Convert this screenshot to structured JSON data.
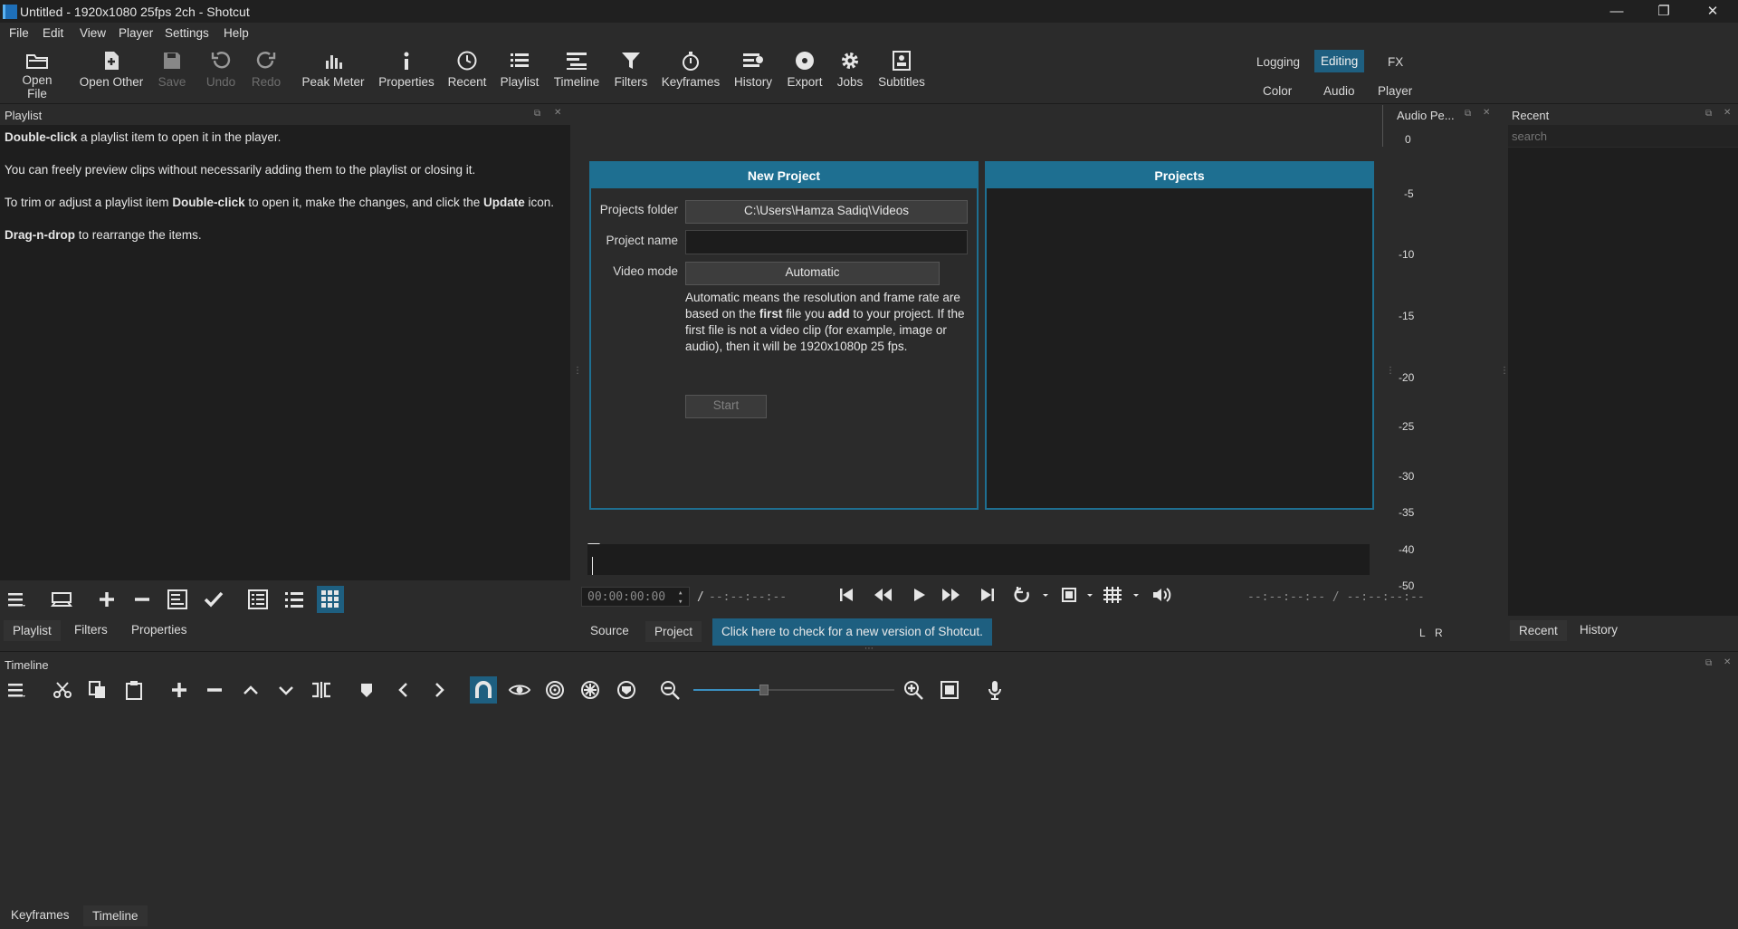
{
  "window": {
    "title": "Untitled - 1920x1080 25fps 2ch - Shotcut",
    "minimize": "—",
    "restore": "❐",
    "close": "✕"
  },
  "menu": [
    "File",
    "Edit",
    "View",
    "Player",
    "Settings",
    "Help"
  ],
  "toolbar": {
    "open_file": "Open File",
    "open_other": "Open Other",
    "save": "Save",
    "undo": "Undo",
    "redo": "Redo",
    "peak_meter": "Peak Meter",
    "properties": "Properties",
    "recent": "Recent",
    "playlist": "Playlist",
    "timeline": "Timeline",
    "filters": "Filters",
    "keyframes": "Keyframes",
    "history": "History",
    "export": "Export",
    "jobs": "Jobs",
    "subtitles": "Subtitles"
  },
  "workspace": {
    "logging": "Logging",
    "editing": "Editing",
    "fx": "FX",
    "color": "Color",
    "audio": "Audio",
    "player": "Player"
  },
  "playlist": {
    "title": "Playlist",
    "line1_bold": "Double-click",
    "line1_rest": " a playlist item to open it in the player.",
    "line2": "You can freely preview clips without necessarily adding them to the playlist or closing it.",
    "line3_a": "To trim or adjust a playlist item ",
    "line3_bold1": "Double-click",
    "line3_b": " to open it, make the changes, and click the ",
    "line3_bold2": "Update",
    "line3_c": " icon.",
    "line4_bold": "Drag-n-drop",
    "line4_rest": " to rearrange the items.",
    "tabs": [
      "Playlist",
      "Filters",
      "Properties"
    ]
  },
  "new_project": {
    "title": "New Project",
    "folder_label": "Projects folder",
    "folder_value": "C:\\Users\\Hamza Sadiq\\Videos",
    "name_label": "Project name",
    "name_value": "",
    "mode_label": "Video mode",
    "mode_value": "Automatic",
    "desc_a": "Automatic means the resolution and frame rate are based on the ",
    "desc_first": "first",
    "desc_b": " file you ",
    "desc_add": "add",
    "desc_c": " to your project. If the first file is not a video clip (for example, image or audio), then it will be 1920x1080p 25 fps.",
    "start": "Start"
  },
  "projects": {
    "title": "Projects"
  },
  "player": {
    "timecode": "00:00:00:00",
    "slash": "/",
    "duration": "--:--:--:--",
    "in_out": "--:--:--:-- / --:--:--:--",
    "source_tab": "Source",
    "project_tab": "Project",
    "update_notice": "Click here to check for a new version of Shotcut."
  },
  "audio_meter": {
    "title": "Audio Pe...",
    "scale": [
      "0",
      "-5",
      "-10",
      "-15",
      "-20",
      "-25",
      "-30",
      "-35",
      "-40",
      "-50"
    ],
    "left": "L",
    "right": "R"
  },
  "recent": {
    "title": "Recent",
    "search_placeholder": "search",
    "tabs": [
      "Recent",
      "History"
    ]
  },
  "timeline": {
    "title": "Timeline",
    "zoom_level": 0.35,
    "bottom_tabs": [
      "Keyframes",
      "Timeline"
    ]
  },
  "colors": {
    "accent": "#1e6f91",
    "active": "#1e5f80",
    "panel": "#1e1e1e",
    "chrome": "#2b2b2b"
  }
}
